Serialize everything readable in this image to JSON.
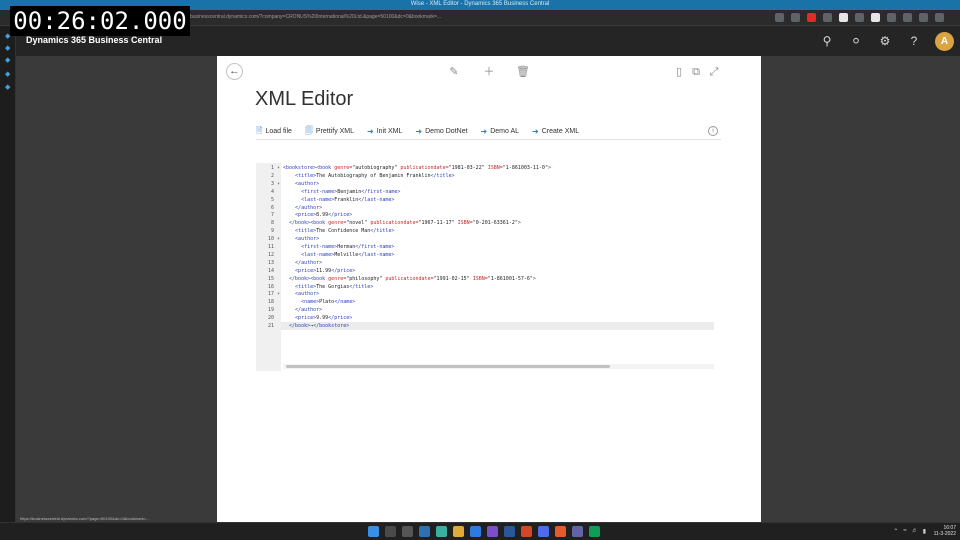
{
  "overlay": {
    "timestamp": "00:26:02.000"
  },
  "browser": {
    "window_title": "Wise - XML Editor - Dynamics 365 Business Central",
    "url": "businesscentral.dynamics.com/?company=CRONUS%20International%20Ltd.&page=50100&dc=0&bookmark=..."
  },
  "app": {
    "name": "Dynamics 365 Business Central",
    "avatar_initial": "A",
    "icons": [
      "search-icon",
      "bell-icon",
      "gear-icon",
      "help-icon"
    ],
    "help_glyph": "?"
  },
  "page": {
    "title": "XML Editor",
    "actions": [
      {
        "label": "Load file",
        "icon": "file-icon"
      },
      {
        "label": "Prettify XML",
        "icon": "document-icon"
      },
      {
        "label": "Init XML",
        "icon": "run-icon"
      },
      {
        "label": "Demo DotNet",
        "icon": "run-icon"
      },
      {
        "label": "Demo AL",
        "icon": "run-icon"
      },
      {
        "label": "Create XML",
        "icon": "run-icon"
      }
    ]
  },
  "editor": {
    "active_line": 21,
    "folded_markers": [
      1,
      3,
      10,
      17
    ],
    "lines": [
      [
        [
          "tag",
          "<bookstore><book "
        ],
        [
          "attr",
          "genre="
        ],
        [
          "val",
          "\"autobiography\" "
        ],
        [
          "attr",
          "publicationdate="
        ],
        [
          "val",
          "\"1981-03-22\" "
        ],
        [
          "attr",
          "ISBN="
        ],
        [
          "val",
          "\"1-861003-11-0\""
        ],
        [
          "tag",
          ">"
        ]
      ],
      [
        [
          "val",
          "    "
        ],
        [
          "tag",
          "<title>"
        ],
        [
          "val",
          "The Autobiography of Benjamin Franklin"
        ],
        [
          "tag",
          "</title>"
        ]
      ],
      [
        [
          "val",
          "    "
        ],
        [
          "tag",
          "<author>"
        ]
      ],
      [
        [
          "val",
          "      "
        ],
        [
          "tag",
          "<first-name>"
        ],
        [
          "val",
          "Benjamin"
        ],
        [
          "tag",
          "</first-name>"
        ]
      ],
      [
        [
          "val",
          "      "
        ],
        [
          "tag",
          "<last-name>"
        ],
        [
          "val",
          "Franklin"
        ],
        [
          "tag",
          "</last-name>"
        ]
      ],
      [
        [
          "val",
          "    "
        ],
        [
          "tag",
          "</author>"
        ]
      ],
      [
        [
          "val",
          "    "
        ],
        [
          "tag",
          "<price>"
        ],
        [
          "val",
          "8.99"
        ],
        [
          "tag",
          "</price>"
        ]
      ],
      [
        [
          "val",
          "  "
        ],
        [
          "tag",
          "</book><book "
        ],
        [
          "attr",
          "genre="
        ],
        [
          "val",
          "\"novel\" "
        ],
        [
          "attr",
          "publicationdate="
        ],
        [
          "val",
          "\"1967-11-17\" "
        ],
        [
          "attr",
          "ISBN="
        ],
        [
          "val",
          "\"0-201-63361-2\""
        ],
        [
          "tag",
          ">"
        ]
      ],
      [
        [
          "val",
          "    "
        ],
        [
          "tag",
          "<title>"
        ],
        [
          "val",
          "The Confidence Man"
        ],
        [
          "tag",
          "</title>"
        ]
      ],
      [
        [
          "val",
          "    "
        ],
        [
          "tag",
          "<author>"
        ]
      ],
      [
        [
          "val",
          "      "
        ],
        [
          "tag",
          "<first-name>"
        ],
        [
          "val",
          "Herman"
        ],
        [
          "tag",
          "</first-name>"
        ]
      ],
      [
        [
          "val",
          "      "
        ],
        [
          "tag",
          "<last-name>"
        ],
        [
          "val",
          "Melville"
        ],
        [
          "tag",
          "</last-name>"
        ]
      ],
      [
        [
          "val",
          "    "
        ],
        [
          "tag",
          "</author>"
        ]
      ],
      [
        [
          "val",
          "    "
        ],
        [
          "tag",
          "<price>"
        ],
        [
          "val",
          "11.99"
        ],
        [
          "tag",
          "</price>"
        ]
      ],
      [
        [
          "val",
          "  "
        ],
        [
          "tag",
          "</book><book "
        ],
        [
          "attr",
          "genre="
        ],
        [
          "val",
          "\"philosophy\" "
        ],
        [
          "attr",
          "publicationdate="
        ],
        [
          "val",
          "\"1991-02-15\" "
        ],
        [
          "attr",
          "ISBN="
        ],
        [
          "val",
          "\"1-861001-57-6\""
        ],
        [
          "tag",
          ">"
        ]
      ],
      [
        [
          "val",
          "    "
        ],
        [
          "tag",
          "<title>"
        ],
        [
          "val",
          "The Gorgias"
        ],
        [
          "tag",
          "</title>"
        ]
      ],
      [
        [
          "val",
          "    "
        ],
        [
          "tag",
          "<author>"
        ]
      ],
      [
        [
          "val",
          "      "
        ],
        [
          "tag",
          "<name>"
        ],
        [
          "val",
          "Plato"
        ],
        [
          "tag",
          "</name>"
        ]
      ],
      [
        [
          "val",
          "    "
        ],
        [
          "tag",
          "</author>"
        ]
      ],
      [
        [
          "val",
          "    "
        ],
        [
          "tag",
          "<price>"
        ],
        [
          "val",
          "9.99"
        ],
        [
          "tag",
          "</price>"
        ]
      ],
      [
        [
          "val",
          "  "
        ],
        [
          "tag",
          "</book>"
        ],
        [
          "val",
          "→"
        ],
        [
          "tag",
          "</bookstore>"
        ]
      ]
    ]
  },
  "status_bar": {
    "link_preview": "https://businesscentral.dynamics.com/?page=50100&dc=0&bookmark=..."
  },
  "taskbar": {
    "time": "16:07",
    "date": "11-3-2022"
  }
}
